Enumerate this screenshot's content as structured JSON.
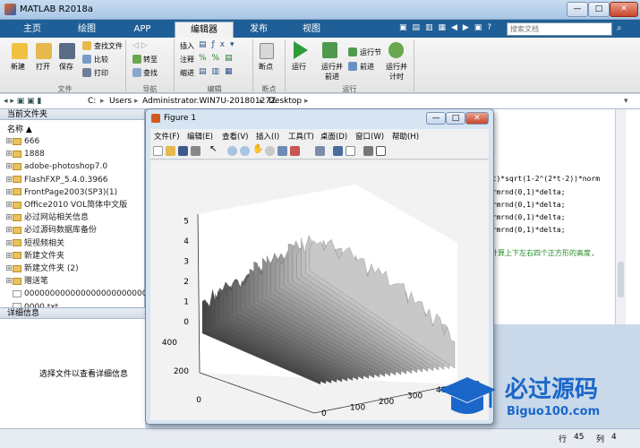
{
  "window": {
    "title": "MATLAB R2018a",
    "min": "—",
    "max": "□",
    "close": "✕"
  },
  "tabs": [
    "主页",
    "绘图",
    "APP",
    "编辑器",
    "发布",
    "视图"
  ],
  "search_placeholder": "搜索文档",
  "ribbon": {
    "new": "新建",
    "open": "打开",
    "save": "保存",
    "find_files": "查找文件",
    "compare": "比较",
    "print": "打印",
    "goto": "转至",
    "find": "查找",
    "insert": "插入",
    "comment": "注释",
    "indent": "缩进",
    "breakpoints": "断点",
    "run": "运行",
    "run_advance": "运行并前进",
    "run_section": "运行节",
    "advance": "前进",
    "run_time": "运行并计时",
    "groups": {
      "file": "文件",
      "nav": "导航",
      "edit": "编辑",
      "bp": "断点",
      "run": "运行"
    }
  },
  "address": {
    "path": [
      "C:",
      "Users",
      "Administrator.WIN7U-20180127Z",
      "Desktop"
    ]
  },
  "current_folder": {
    "header": "当前文件夹",
    "col_name": "名称 ▲",
    "items": [
      "666",
      "1888",
      "adobe-photoshop7.0",
      "FlashFXP_5.4.0.3966",
      "FrontPage2003(SP3)(1)",
      "Office2010 VOL简体中文版",
      "必过网站相关信息",
      "必过源码数据库备份",
      "短视频相关",
      "新建文件夹",
      "新建文件夹 (2)",
      "赠送笔",
      "000000000000000000000000...",
      "0000.txt",
      "000000000000000-插图LOGO.f..."
    ]
  },
  "details": {
    "header": "详细信息",
    "message": "选择文件以查看详细信息"
  },
  "editor": {
    "lines": [
      "h*t)*sqrt(1-2^(2*t-2))*norm",
      "normrnd(0,1)*delta;",
      "normrnd(0,1)*delta;",
      "normrnd(0,1)*delta;",
      "normrnd(0,1)*delta;"
    ],
    "comment": "别计算上下左右四个正方形的高度,"
  },
  "status": {
    "row_label": "行",
    "row": "45",
    "col_label": "列",
    "col": "4"
  },
  "figure": {
    "title": "Figure 1",
    "menu": [
      "文件(F)",
      "编辑(E)",
      "查看(V)",
      "插入(I)",
      "工具(T)",
      "桌面(D)",
      "窗口(W)",
      "帮助(H)"
    ],
    "zticks": [
      "0",
      "1",
      "2",
      "3",
      "4",
      "5"
    ],
    "yticks": [
      "0",
      "200",
      "400"
    ],
    "xticks": [
      "0",
      "100",
      "200",
      "300",
      "400",
      "500"
    ]
  },
  "logo": {
    "cn": "必过源码",
    "url": "Biguo100.com"
  },
  "colors": {
    "accent": "#1f5f98",
    "logo": "#1a67c9"
  }
}
